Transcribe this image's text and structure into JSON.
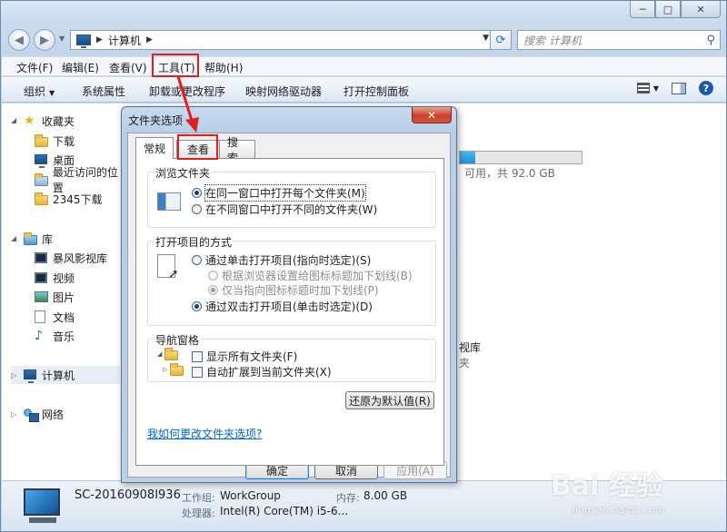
{
  "window": {
    "caption_buttons": [
      "─",
      "□",
      "✕"
    ]
  },
  "address": {
    "path": "计算机",
    "search_placeholder": "搜索 计算机"
  },
  "menubar": {
    "items": [
      "文件(F)",
      "编辑(E)",
      "查看(V)",
      "工具(T)",
      "帮助(H)"
    ]
  },
  "commandbar": {
    "items": [
      "组织",
      "系统属性",
      "卸载或更改程序",
      "映射网络驱动器",
      "打开控制面板"
    ]
  },
  "navpane": {
    "favorites": "收藏夹",
    "fav_items": [
      "下载",
      "桌面",
      "最近访问的位置",
      "2345下载"
    ],
    "libraries": "库",
    "lib_items": [
      "暴风影视库",
      "视频",
      "图片",
      "文档",
      "音乐"
    ],
    "computer": "计算机",
    "network": "网络"
  },
  "content": {
    "drive_free": "可用，共 92.0 GB",
    "partial_item_1": "视库",
    "partial_item_2": "夹"
  },
  "details": {
    "computer_name": "SC-20160908I936",
    "workgroup_label": "工作组:",
    "workgroup_value": "WorkGroup",
    "memory_label": "内存:",
    "memory_value": "8.00 GB",
    "cpu_label": "处理器:",
    "cpu_value": "Intel(R) Core(TM) i5-6..."
  },
  "dialog": {
    "title": "文件夹选项",
    "close": "✕",
    "tabs": [
      "常规",
      "查看",
      "搜索"
    ],
    "group_browse": {
      "label": "浏览文件夹",
      "options": [
        "在同一窗口中打开每个文件夹(M)",
        "在不同窗口中打开不同的文件夹(W)"
      ]
    },
    "group_open": {
      "label": "打开项目的方式",
      "options": [
        "通过单击打开项目(指向时选定)(S)",
        "根据浏览器设置给图标标题加下划线(B)",
        "仅当指向图标标题时加下划线(P)",
        "通过双击打开项目(单击时选定)(D)"
      ]
    },
    "group_nav": {
      "label": "导航窗格",
      "options": [
        "显示所有文件夹(F)",
        "自动扩展到当前文件夹(X)"
      ]
    },
    "restore_defaults": "还原为默认值(R)",
    "help_link": "我如何更改文件夹选项?",
    "ok": "确定",
    "cancel": "取消",
    "apply": "应用(A)"
  },
  "watermark": {
    "brand": "Bai 经验",
    "url": "jingyan.baidu.com"
  },
  "colors": {
    "highlight_red": "#e02020",
    "link_blue": "#0066cc"
  }
}
